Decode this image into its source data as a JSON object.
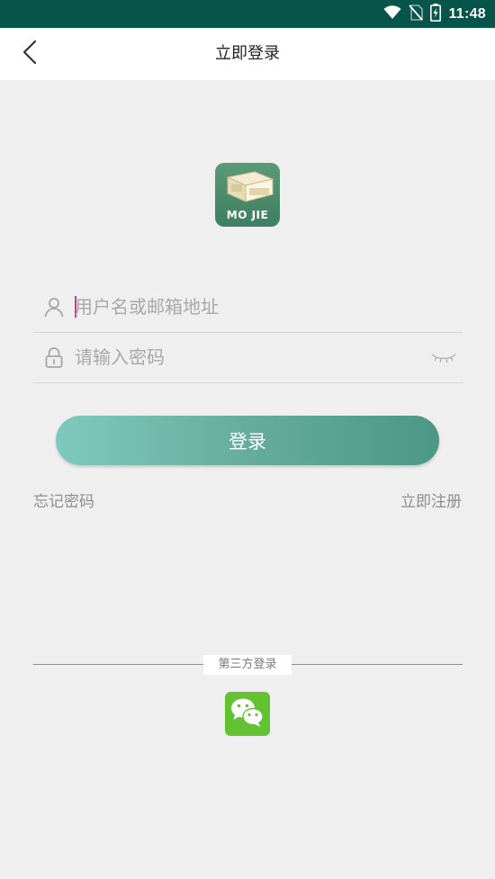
{
  "status_bar": {
    "time": "11:48",
    "icons": [
      "wifi-icon",
      "no-sim-icon",
      "battery-charging-icon"
    ]
  },
  "header": {
    "title": "立即登录",
    "back_icon": "chevron-left-icon"
  },
  "logo": {
    "text": "MO JIE"
  },
  "form": {
    "username_placeholder": "用户名或邮箱地址",
    "password_placeholder": "请输入密码",
    "login_label": "登录",
    "forgot_password_label": "忘记密码",
    "register_label": "立即注册"
  },
  "third_party": {
    "label": "第三方登录",
    "wechat_icon": "wechat-icon"
  },
  "colors": {
    "status_bar": "#07544a",
    "button_start": "#7fc8bd",
    "button_end": "#4b9884",
    "wechat_green": "#62c231",
    "background": "#efefef"
  }
}
